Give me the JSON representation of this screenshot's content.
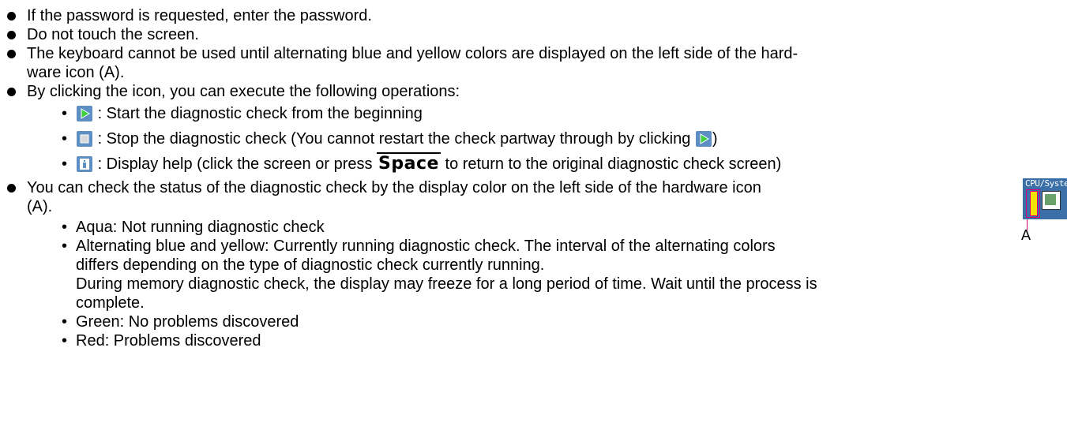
{
  "bullets": {
    "b1": "If the password is requested, enter the password.",
    "b2": "Do not touch the screen.",
    "b3_line1": "The keyboard cannot be used until alternating blue and yellow colors are displayed on the left side of the hard-",
    "b3_line2": "ware icon (A).",
    "b4": "By clicking the icon, you can execute the following operations:",
    "b5_line1": "You can check the status of the diagnostic check by the display color on the left side of the hardware icon",
    "b5_line2": "(A)."
  },
  "operations": {
    "start_text": ": Start the diagnostic check from the beginning",
    "stop_text_before": ": Stop the diagnostic check (You cannot restart the check partway through by clicking",
    "stop_text_after": ")",
    "help_text_before": ": Display help (click the screen or press",
    "help_key": "Space",
    "help_text_after": "to return to the original diagnostic check screen)"
  },
  "status": {
    "aqua": "Aqua: Not running diagnostic check",
    "alt_line1": "Alternating blue and yellow: Currently running diagnostic check. The interval of the alternating colors",
    "alt_line2": "differs depending on the type of diagnostic check currently running.",
    "alt_line3": "During memory diagnostic check, the display may freeze for a long period of time. Wait until the process is",
    "alt_line4": "complete.",
    "green": "Green: No problems discovered",
    "red": "Red: Problems discovered"
  },
  "hardware_icon": {
    "label": "CPU/System",
    "callout": "A"
  },
  "icons": {
    "start": "play-icon",
    "stop": "stop-icon",
    "help": "help-icon"
  },
  "colors": {
    "icon_bg": "#5d8ec4",
    "play_green": "#3fd13f",
    "callout": "#d2007a",
    "status_yellow": "#f4e300"
  }
}
